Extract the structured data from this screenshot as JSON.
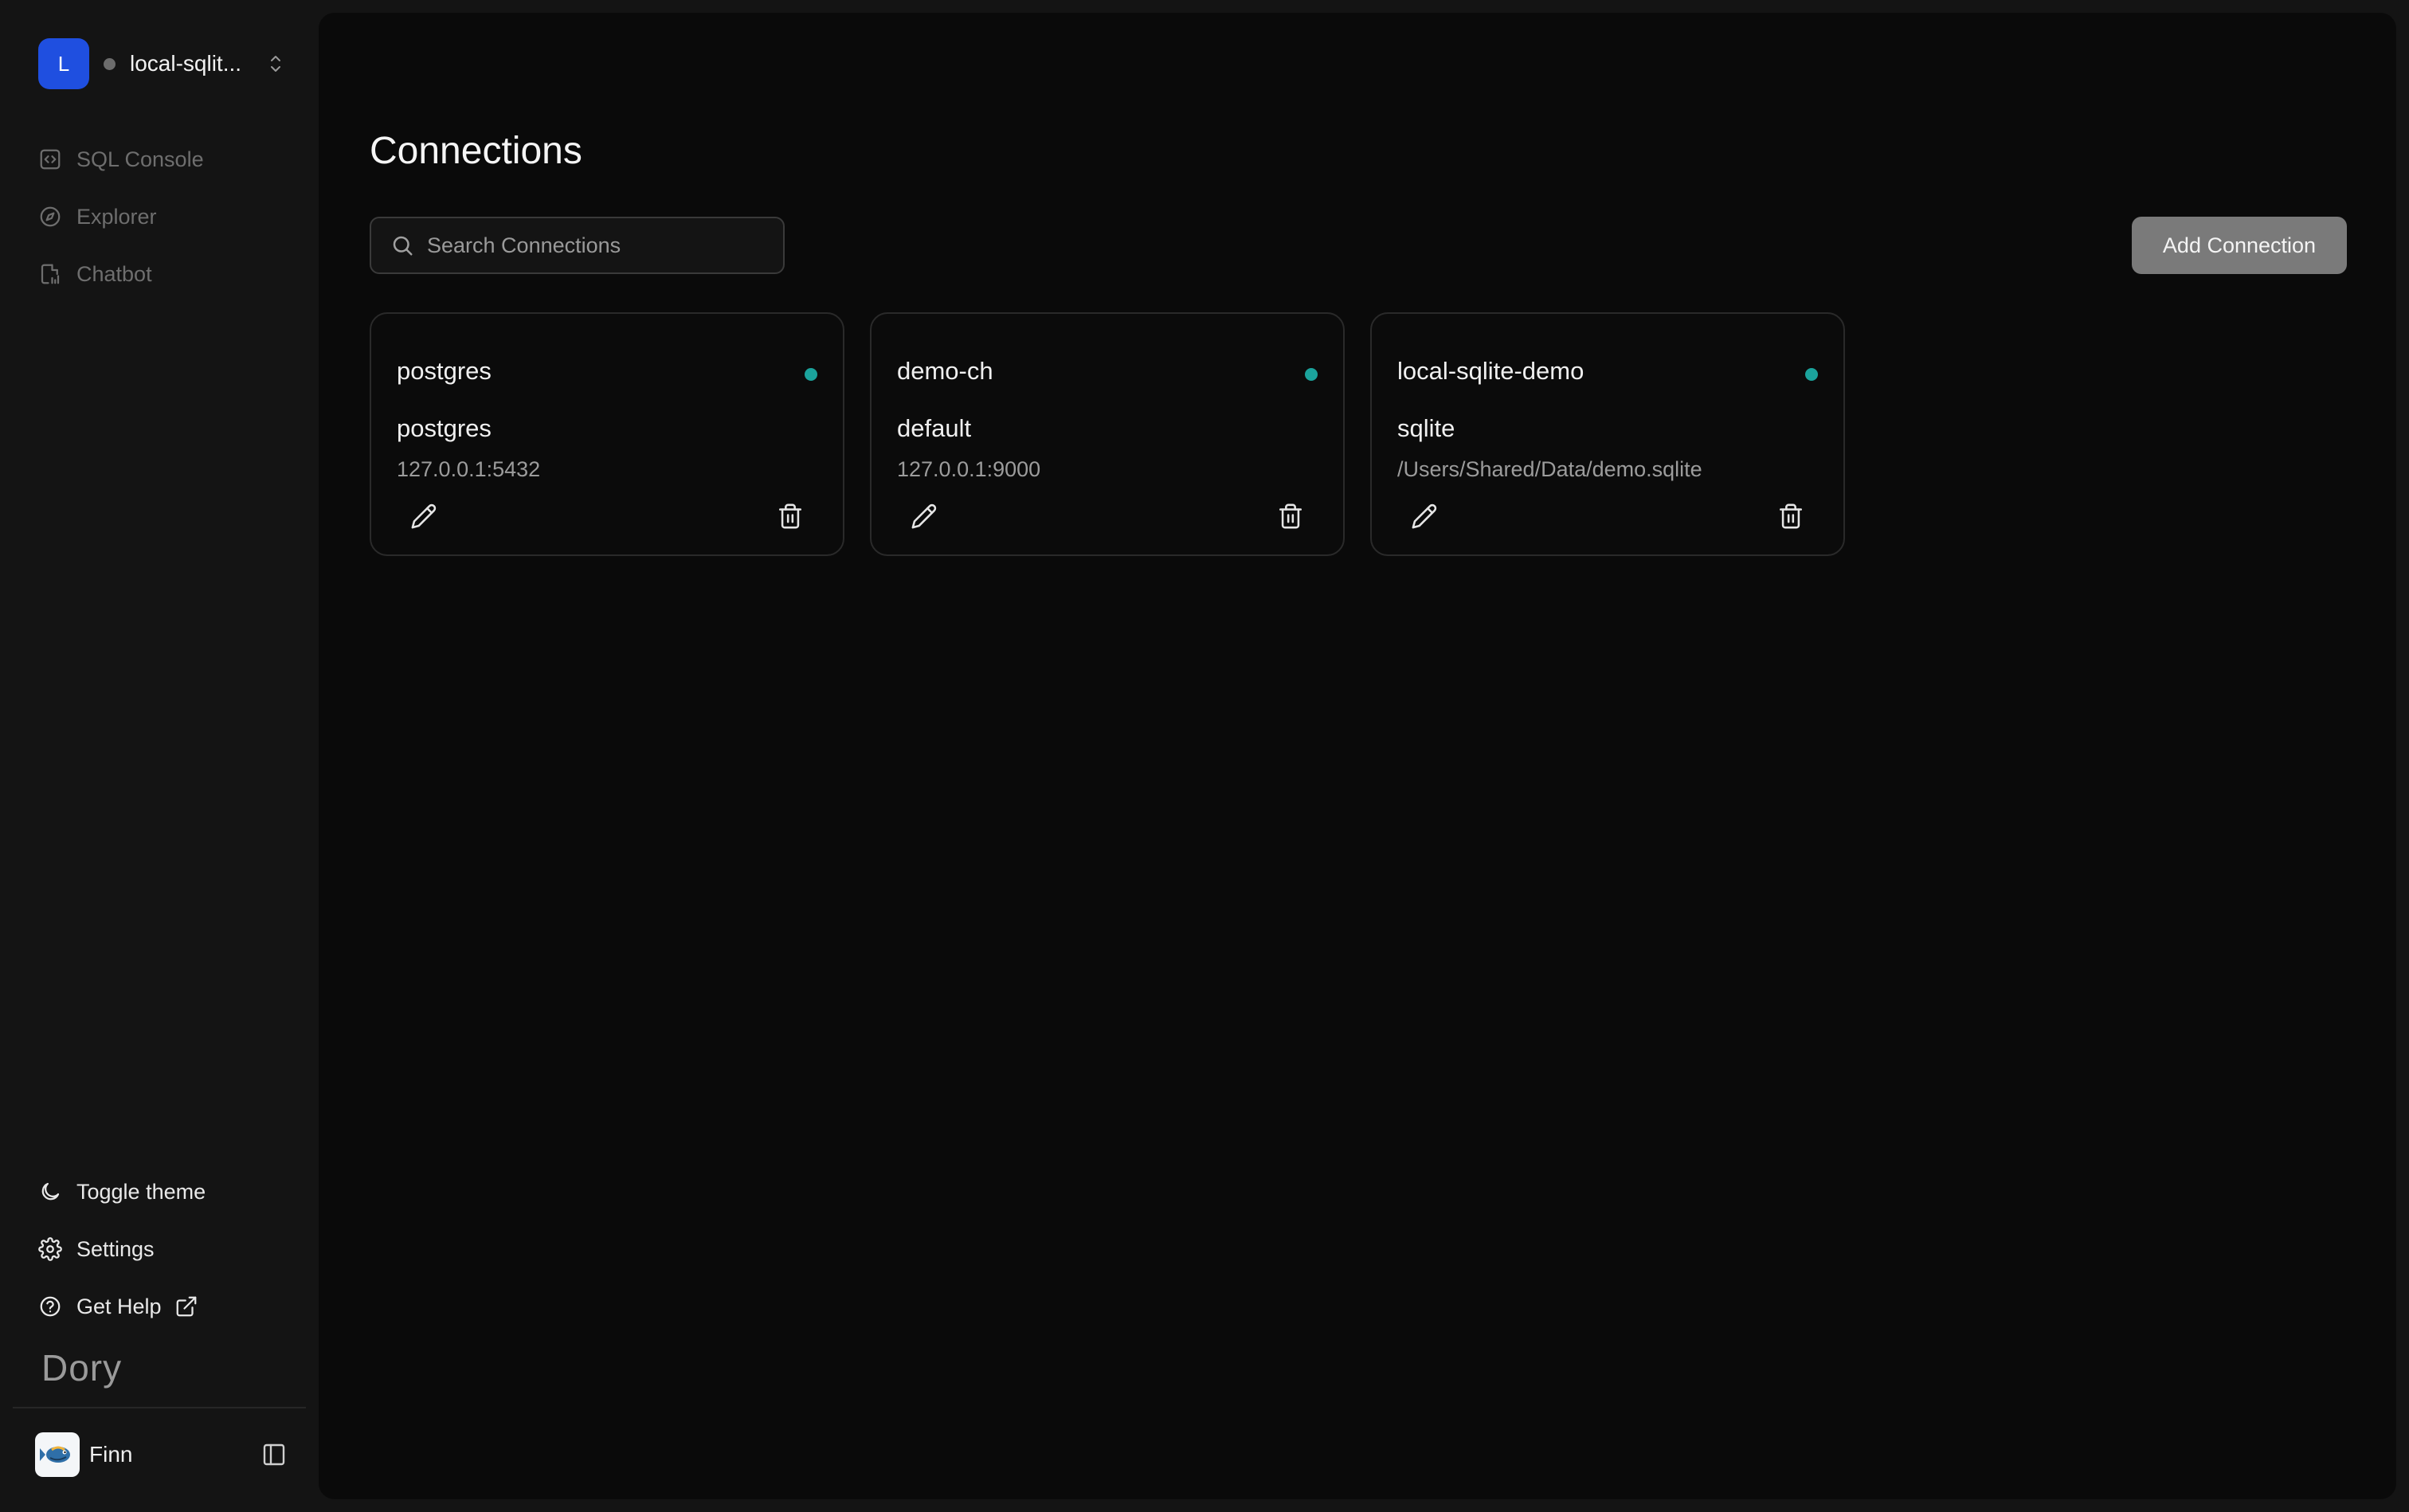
{
  "workspace": {
    "avatar_letter": "L",
    "name": "local-sqlit..."
  },
  "sidebar": {
    "nav": [
      {
        "label": "SQL Console",
        "icon": "code-square-icon"
      },
      {
        "label": "Explorer",
        "icon": "compass-icon"
      },
      {
        "label": "Chatbot",
        "icon": "file-chart-icon"
      }
    ],
    "bottom": [
      {
        "label": "Toggle theme",
        "icon": "moon-icon"
      },
      {
        "label": "Settings",
        "icon": "gear-icon"
      },
      {
        "label": "Get Help",
        "icon": "help-circle-icon",
        "extra_icon": "external-link-icon"
      }
    ],
    "brand": "Dory",
    "user": {
      "name": "Finn",
      "avatar_icon": "fish-avatar-icon"
    }
  },
  "main": {
    "title": "Connections",
    "search": {
      "placeholder": "Search Connections",
      "value": ""
    },
    "add_button": "Add Connection",
    "connections": [
      {
        "name": "postgres",
        "database": "postgres",
        "host": "127.0.0.1:5432",
        "status": "connected"
      },
      {
        "name": "demo-ch",
        "database": "default",
        "host": "127.0.0.1:9000",
        "status": "connected"
      },
      {
        "name": "local-sqlite-demo",
        "database": "sqlite",
        "host": "/Users/Shared/Data/demo.sqlite",
        "status": "connected"
      }
    ]
  },
  "colors": {
    "accent_blue": "#1f4fe0",
    "status_green": "#1ba39c",
    "button_grey": "#7a7a7a",
    "main_bg": "#0a0a0a",
    "sidebar_bg": "#141414"
  }
}
